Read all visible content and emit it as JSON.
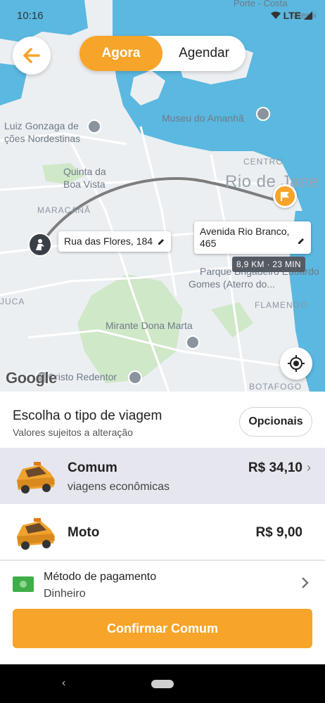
{
  "status_bar": {
    "time": "10:16",
    "network": "LTE"
  },
  "header": {
    "back_icon": "arrow-left-icon",
    "tabs": [
      {
        "label": "Agora",
        "active": true
      },
      {
        "label": "Agendar",
        "active": false
      }
    ]
  },
  "map": {
    "labels": {
      "porto": "Porte - Costa",
      "niteroi": "Niterói",
      "museu": "Museu do Amanhã",
      "gonzaga_1": "Luiz Gonzaga de",
      "gonzaga_2": "ções Nordestinas",
      "centro": "CENTRO",
      "quinta_1": "Quinta da",
      "quinta_2": "Boa Vista",
      "rio": "Rio de Jane",
      "maracana": "MARACANÃ",
      "parque_1": "Parque Brigadeiro Eduardo",
      "parque_2": "Gomes (Aterro do...",
      "tijuca": "JUCA",
      "flamengo": "FLAMENGO",
      "mirante": "Mirante Dona Marta",
      "cristo": "Cristo Redentor",
      "botafogo": "BOTAFOGO",
      "google": "Google"
    },
    "origin_label": "Rua das Flores, 184",
    "destination_label_1": "Avenida Rio Branco,",
    "destination_label_2": "465",
    "eta": "8,9 KM · 23 MIN",
    "colors": {
      "water": "#5bb8e0",
      "land": "#eceff2",
      "park": "#cfe8c8",
      "accent": "#f7a42a"
    }
  },
  "panel": {
    "title": "Escolha o tipo de viagem",
    "subtitle": "Valores sujeitos a alteração",
    "options_button": "Opcionais",
    "rides": [
      {
        "name": "Comum",
        "description": "viagens econômicas",
        "price": "R$ 34,10",
        "selected": true
      },
      {
        "name": "Moto",
        "description": "",
        "price": "R$ 9,00",
        "selected": false
      }
    ],
    "payment": {
      "label": "Método de pagamento",
      "value": "Dinheiro"
    },
    "confirm_button": "Confirmar Comum"
  }
}
